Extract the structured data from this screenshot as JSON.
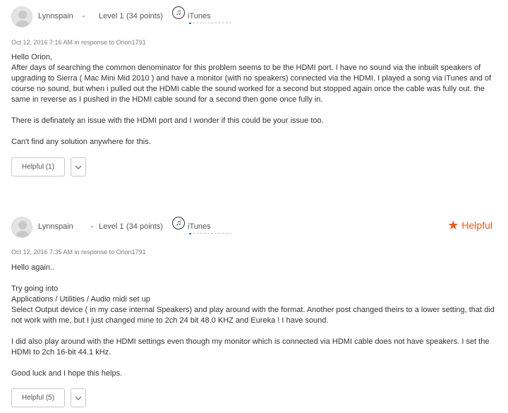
{
  "posts": [
    {
      "username": "Lynnspain",
      "level": "Level 1",
      "points": "(34 points)",
      "community_label": "iTunes",
      "community_icon": "music-note-icon",
      "progress_fraction": 0.05,
      "meta": "Oct 12, 2016 7:16 AM in response to Orion1791",
      "paragraphs": [
        "Hello Orion,",
        "After days of searching the common denominator for this problem seems to be the HDMI port.  I have no sound via the inbuilt speakers of upgrading to Sierra ( Mac Mini Mid 2010 ) and have a monitor (with no speakers) connected via the HDMI.  I played a song via iTunes and of course no sound, but when i pulled out the HDMI cable the sound worked for a second but stopped again once the cable was fully out.  the same in reverse as I pushed in  the HDMI cable sound for a second then gone once fully in.",
        "",
        "There is definately an issue with the HDMI port and I wonder if this could be your issue too.",
        "",
        "Can't find any solution anywhere for this."
      ],
      "helpful_button": "Helpful (1)",
      "helpful_marked": null
    },
    {
      "username": "Lynnspain",
      "level": "Level 1",
      "points": "(34 points)",
      "community_label": "iTunes",
      "community_icon": "music-note-icon",
      "progress_fraction": 0.05,
      "meta": "Oct 12, 2016 7:35 AM in response to Orion1791",
      "paragraphs": [
        "Hello again..",
        "",
        "Try going into",
        "Applications / Utilities / Audio midi set up",
        "Select Output device ( in my case internal Speakers) and play around with the format.  Another post changed theirs to a lower setting, that did not work with me, but I just changed mine to 2ch 24 bit 48.0 KHZ and Eureka !  I have sound.",
        "",
        "I did also play around with the HDMI settings even though my monitor which is connected via HDMI cable does not have speakers.  I set the HDMI to 2ch 16-bit 44.1 kHz.",
        "",
        "Good luck and I hope this helps."
      ],
      "helpful_button": "Helpful (5)",
      "helpful_marked": "Helpful"
    }
  ],
  "colors": {
    "accent_orange": "#ef5a24",
    "progress_blue": "#0a72e8",
    "meta_gray": "#7d7d7d"
  }
}
